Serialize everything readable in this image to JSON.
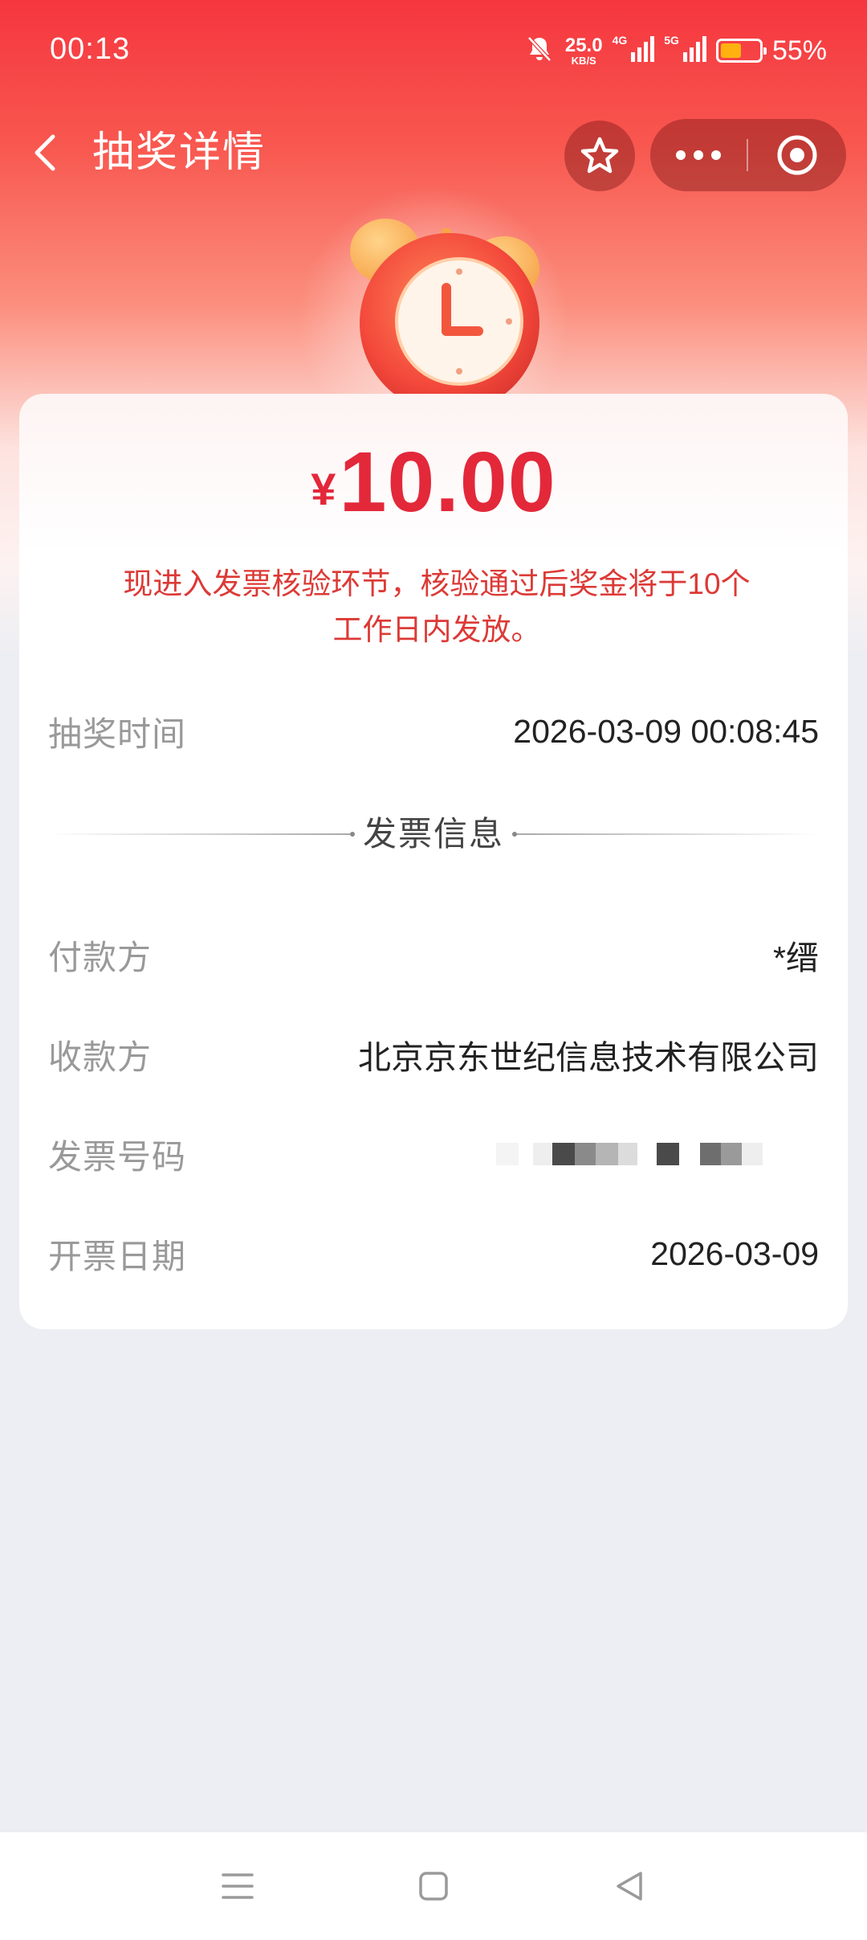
{
  "status_bar": {
    "time": "00:13",
    "net_speed": "25.0",
    "net_speed_unit": "KB/S",
    "sim1_label": "4G",
    "sim2_label": "5G",
    "battery_percent": "55%",
    "battery_level": 0.55,
    "battery_color": "#ffb20f"
  },
  "nav": {
    "title": "抽奖详情",
    "back_icon": "chevron-left-icon",
    "favorite_icon": "star-icon",
    "more_icon": "more-dots-icon",
    "close_icon": "target-circle-icon"
  },
  "prize": {
    "currency": "¥",
    "amount": "10.00",
    "notice": "现进入发票核验环节，核验通过后奖金将于10个工作日内发放。",
    "accent_color": "#e3283a"
  },
  "draw": {
    "time_label": "抽奖时间",
    "time_value": "2026-03-09 00:08:45"
  },
  "invoice": {
    "section_title": "发票信息",
    "payer_label": "付款方",
    "payer_value": "*缙",
    "payee_label": "收款方",
    "payee_value": "北京京东世纪信息技术有限公司",
    "number_label": "发票号码",
    "date_label": "开票日期",
    "date_value": "2026-03-09"
  },
  "system_nav": {
    "menu_icon": "menu-lines-icon",
    "home_icon": "square-home-icon",
    "back_icon": "triangle-back-icon"
  }
}
